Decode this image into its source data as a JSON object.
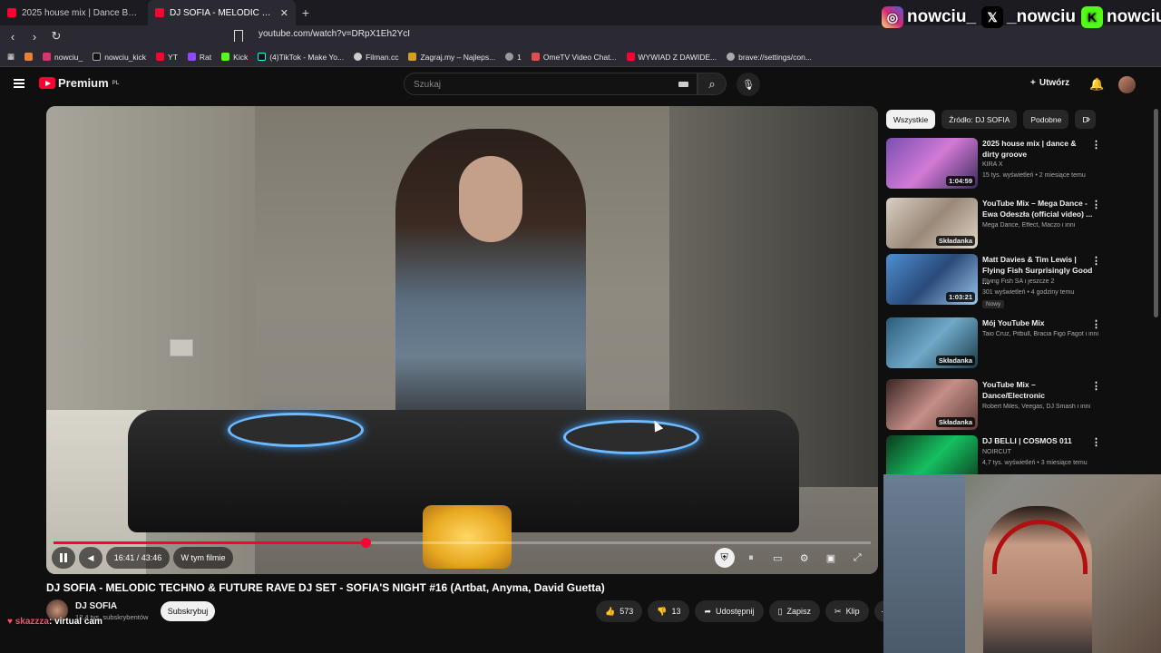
{
  "browser": {
    "tabs": [
      {
        "title": "2025 house mix | Dance Bangers - Yo",
        "active": false
      },
      {
        "title": "DJ SOFIA - MELODIC TECHNO",
        "active": true
      }
    ],
    "new_tab": "+",
    "url": "youtube.com/watch?v=DRpX1Eh2YcI",
    "bookmarks": [
      "nowciu_",
      "nowciu_kick",
      "YT",
      "Rat",
      "Kick",
      "(4)TikTok - Make Yo...",
      "Filman.cc",
      "Zagraj.my – Najleps...",
      "1",
      "OmeTV Video Chat...",
      "WYWIAD Z DAWIDE...",
      "brave://settings/con..."
    ]
  },
  "overlay": {
    "socials": [
      {
        "icon": "instagram-icon",
        "handle": "nowciu_",
        "color": "#e1306c"
      },
      {
        "icon": "x-icon",
        "handle": "_nowciu",
        "color": "#000000"
      },
      {
        "icon": "kick-icon",
        "handle": "nowciu",
        "color": "#53fc18"
      }
    ],
    "chat": {
      "user": "skazzza",
      "message": ": virtual cam"
    }
  },
  "youtube": {
    "logo": "Premium",
    "logo_region": "PL",
    "search_placeholder": "Szukaj",
    "create_label": "Utwórz",
    "accent": "#ff0033"
  },
  "player": {
    "time": "16:41 / 43:46",
    "progress": 0.3814,
    "chapter_label": "W tym filmie"
  },
  "video": {
    "title": "DJ SOFIA - MELODIC TECHNO & FUTURE RAVE DJ SET - SOFIA'S NIGHT #16 (Artbat, Anyma, David Guetta)",
    "channel": "DJ SOFIA",
    "subscribers": "12,4 tys. subskrybentów",
    "subscribe_label": "Subskrybuj",
    "likes": "573",
    "dislikes": "13",
    "share_label": "Udostępnij",
    "save_label": "Zapisz",
    "clip_label": "Klip"
  },
  "sidebar": {
    "chips": [
      "Wszystkie",
      "Źródło: DJ SOFIA",
      "Podobne",
      "D"
    ],
    "recommendations": [
      {
        "title": "2025 house mix | dance & dirty groove",
        "channel": "KIRA X",
        "meta": "15 tys. wyświetleń • 2 miesiące temu",
        "duration": "1:04:59",
        "badge": ""
      },
      {
        "title": "YouTube Mix – Mega Dance - Ewa Odeszła (official video) ...",
        "channel": "Mega Dance, Effect, Maczo i inni",
        "meta": "",
        "duration": "Składanka",
        "badge": ""
      },
      {
        "title": "Matt Davies & Tim Lewis | Flying Fish Surprisingly Good ...",
        "channel": "Flying Fish SA i jeszcze 2",
        "meta": "301 wyświetleń • 4 godziny temu",
        "duration": "1:03:21",
        "badge": "Nowy"
      },
      {
        "title": "Mój YouTube Mix",
        "channel": "Taio Cruz, Pitbull, Bracia Figo Fagot i inni",
        "meta": "",
        "duration": "Składanka",
        "badge": ""
      },
      {
        "title": "YouTube Mix – Dance/Electronic",
        "channel": "Robert Miles, Veegas, DJ Smash i inni",
        "meta": "",
        "duration": "Składanka",
        "badge": ""
      },
      {
        "title": "DJ BELLI | COSMOS 011",
        "channel": "NOIRCUT",
        "meta": "4,7 tys. wyświetleń • 3 miesiące temu",
        "duration": "",
        "badge": ""
      }
    ]
  }
}
